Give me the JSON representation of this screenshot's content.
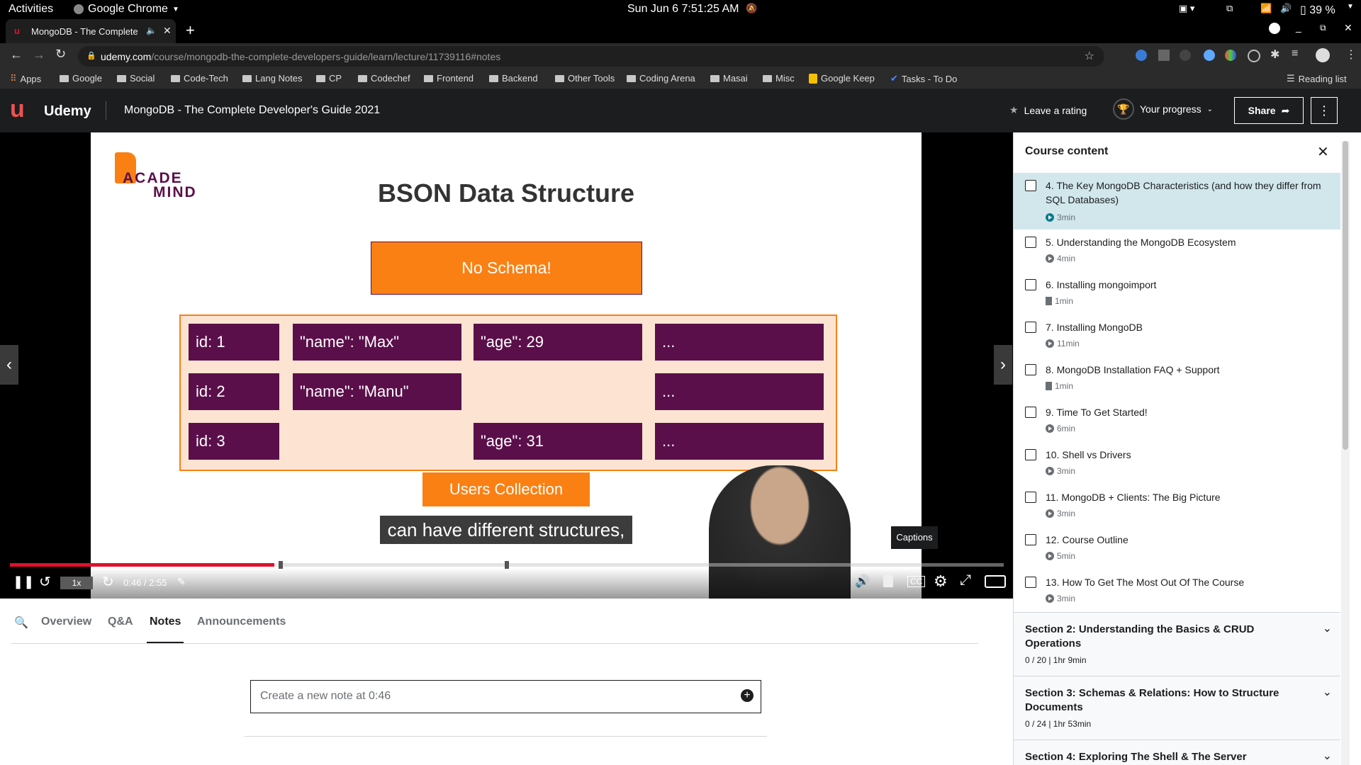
{
  "os": {
    "activities": "Activities",
    "app_name": "Google Chrome",
    "datetime": "Sun Jun 6   7:51:25 AM",
    "battery": "39 %"
  },
  "browser": {
    "tab_title": "MongoDB - The Complete",
    "url_domain": "udemy.com",
    "url_path": "/course/mongodb-the-complete-developers-guide/learn/lecture/11739116#notes",
    "bookmarks": [
      "Apps",
      "Google",
      "Social",
      "Code-Tech",
      "Lang Notes",
      "CP",
      "Codechef",
      "Frontend",
      "Backend",
      "Other Tools",
      "Coding Arena",
      "Masai",
      "Misc",
      "Google Keep",
      "Tasks - To Do"
    ],
    "reading_list": "Reading list"
  },
  "header": {
    "logo": "Udemy",
    "course_title": "MongoDB - The Complete Developer's Guide 2021",
    "leave_rating": "Leave a rating",
    "your_progress": "Your progress",
    "share": "Share"
  },
  "slide": {
    "logo_line1": "ACADE",
    "logo_line2": "MIND",
    "title": "BSON Data Structure",
    "no_schema": "No Schema!",
    "rows": [
      [
        "id: 1",
        "\"name\": \"Max\"",
        "\"age\": 29",
        "..."
      ],
      [
        "id: 2",
        "\"name\": \"Manu\"",
        "",
        "..."
      ],
      [
        "id: 3",
        "",
        "\"age\": 31",
        "..."
      ]
    ],
    "collection_label": "Users Collection",
    "caption": "can have different structures,",
    "captions_tooltip": "Captions"
  },
  "player": {
    "speed": "1x",
    "time": "0:46 / 2:55",
    "progress_fraction": 0.266,
    "buffered_fraction": 0.27
  },
  "tabs": [
    "Overview",
    "Q&A",
    "Notes",
    "Announcements"
  ],
  "active_tab": "Notes",
  "note_input": "Create a new note at 0:46",
  "sidebar": {
    "heading": "Course content",
    "lectures": [
      {
        "title": "4. The Key MongoDB Characteristics (and how they differ from SQL Databases)",
        "meta": "3min",
        "kind": "video",
        "active": true
      },
      {
        "title": "5. Understanding the MongoDB Ecosystem",
        "meta": "4min",
        "kind": "video"
      },
      {
        "title": "6. Installing mongoimport",
        "meta": "1min",
        "kind": "doc"
      },
      {
        "title": "7. Installing MongoDB",
        "meta": "11min",
        "kind": "video"
      },
      {
        "title": "8. MongoDB Installation FAQ + Support",
        "meta": "1min",
        "kind": "doc"
      },
      {
        "title": "9. Time To Get Started!",
        "meta": "6min",
        "kind": "video"
      },
      {
        "title": "10. Shell vs Drivers",
        "meta": "3min",
        "kind": "video"
      },
      {
        "title": "11. MongoDB + Clients: The Big Picture",
        "meta": "3min",
        "kind": "video"
      },
      {
        "title": "12. Course Outline",
        "meta": "5min",
        "kind": "video"
      },
      {
        "title": "13. How To Get The Most Out Of The Course",
        "meta": "3min",
        "kind": "video"
      }
    ],
    "sections": [
      {
        "title": "Section 2: Understanding the Basics & CRUD Operations",
        "meta": "0 / 20 | 1hr 9min"
      },
      {
        "title": "Section 3: Schemas & Relations: How to Structure Documents",
        "meta": "0 / 24 | 1hr 53min"
      },
      {
        "title": "Section 4: Exploring The Shell & The Server",
        "meta": ""
      }
    ]
  },
  "colors": {
    "orange": "#fa8014",
    "purple": "#5b0f4a",
    "peach": "#fde4d2",
    "udemy_red": "#a435f0",
    "progress_red": "#e0102d"
  }
}
